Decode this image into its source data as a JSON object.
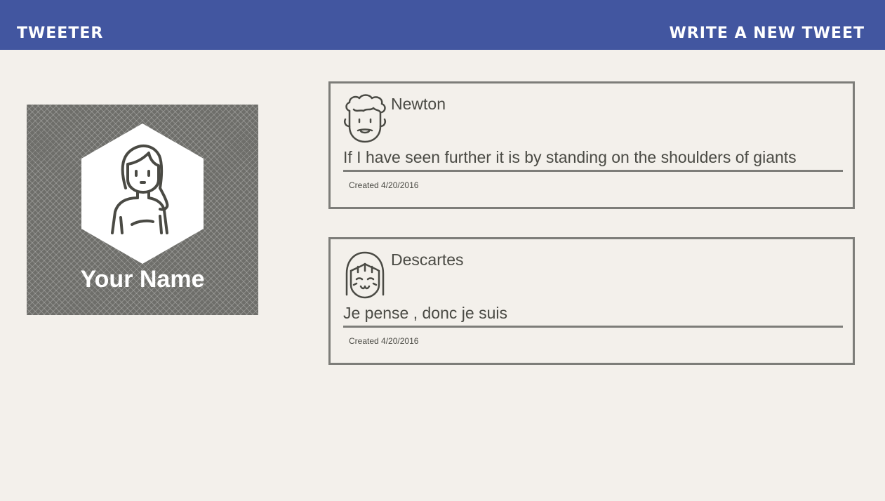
{
  "header": {
    "brand": "Tweeter",
    "compose_label": "Write a new tweet"
  },
  "profile": {
    "name": "Your Name",
    "avatar_icon": "woman-avatar-icon"
  },
  "tweets": [
    {
      "author": "Newton",
      "avatar_icon": "curly-hair-man-avatar-icon",
      "text": "If I have seen further it is by standing on the shoulders of giants",
      "created_label": "Created",
      "date": "4/20/2016"
    },
    {
      "author": "Descartes",
      "avatar_icon": "bob-hair-girl-avatar-icon",
      "text": "Je pense , donc je suis",
      "created_label": "Created",
      "date": "4/20/2016"
    }
  ],
  "colors": {
    "header_bg": "#4256a0",
    "page_bg": "#f3f0eb",
    "border": "#7d7d79",
    "text": "#4a4a44"
  }
}
